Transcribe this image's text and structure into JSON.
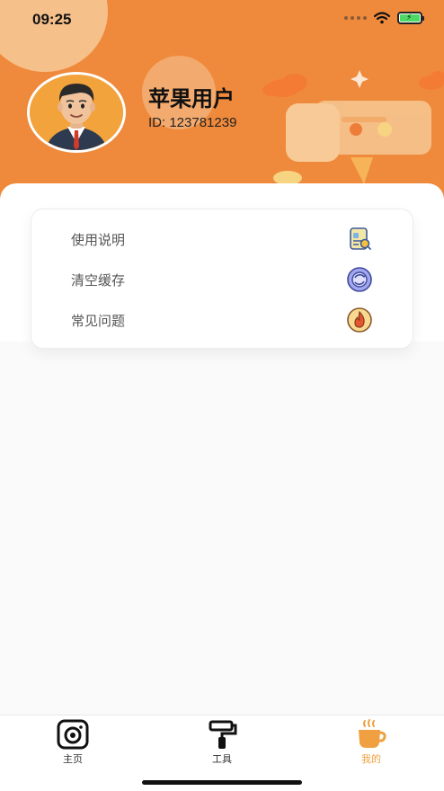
{
  "status_bar": {
    "time": "09:25"
  },
  "profile": {
    "name": "苹果用户",
    "id_text": "ID: 123781239"
  },
  "menu": {
    "items": [
      {
        "label": "使用说明",
        "icon": "document-search-icon"
      },
      {
        "label": "清空缓存",
        "icon": "refresh-circle-icon"
      },
      {
        "label": "常见问题",
        "icon": "flame-icon"
      }
    ]
  },
  "tabbar": {
    "tabs": [
      {
        "label": "主页",
        "icon": "camera-icon",
        "active": false
      },
      {
        "label": "工具",
        "icon": "paint-roller-icon",
        "active": false
      },
      {
        "label": "我的",
        "icon": "coffee-cup-icon",
        "active": true
      }
    ]
  },
  "colors": {
    "header": "#ef8a3c",
    "accent": "#f0a040",
    "background": "#fafafa"
  }
}
